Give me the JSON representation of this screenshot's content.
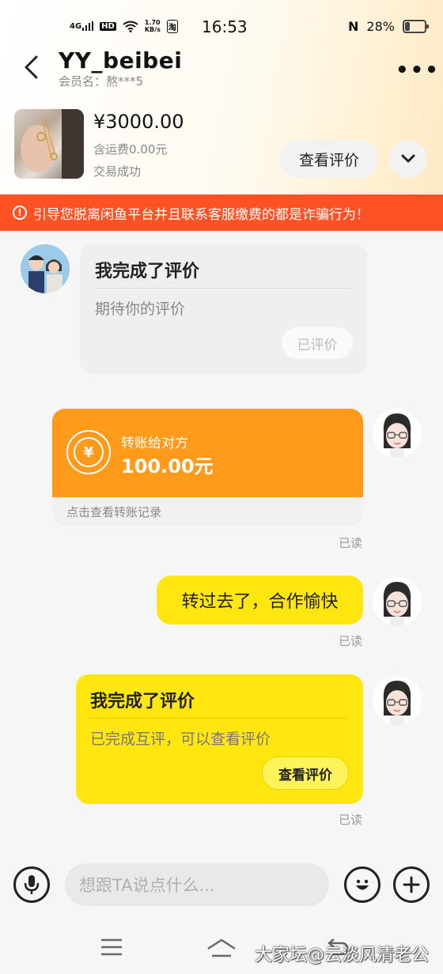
{
  "status_bar": {
    "network": "4G",
    "hd": "HD",
    "speed_value": "1.70",
    "speed_unit": "KB/s",
    "app_badge": "淘",
    "time": "16:53",
    "nfc": "N",
    "battery": "28%"
  },
  "header": {
    "title": "YY_beibei",
    "subtitle": "会员名：熬***5",
    "more": "•••"
  },
  "product": {
    "price": "¥3000.00",
    "shipping": "含运费0.00元",
    "status": "交易成功",
    "review_button": "查看评价"
  },
  "warning": {
    "icon": "!",
    "text": "引导您脱离闲鱼平台并且联系客服缴费的都是诈骗行为！"
  },
  "messages": {
    "review_card_other": {
      "title": "我完成了评价",
      "subtitle": "期待你的评价",
      "button": "已评价"
    },
    "transfer": {
      "label": "转账给对方",
      "amount": "100.00元",
      "footer": "点击查看转账记录",
      "yen": "¥",
      "read": "已读"
    },
    "text_bubble": {
      "text": "转过去了，合作愉快",
      "read": "已读"
    },
    "review_card_mine": {
      "title": "我完成了评价",
      "subtitle": "已完成互评，可以查看评价",
      "button": "查看评价",
      "read": "已读"
    }
  },
  "input_bar": {
    "placeholder": "想跟TA说点什么..."
  },
  "watermark": "大家坛@云淡风清老公",
  "colors": {
    "warning_bg": "#ff5224",
    "transfer_bg": "#ff9a1a",
    "my_bubble": "#ffe60f",
    "other_card": "#efeff1"
  },
  "icons": {
    "back": "chevron-left-icon",
    "expand": "chevron-down-icon",
    "voice": "microphone-icon",
    "emoji": "smile-icon",
    "plus": "plus-icon",
    "nav_menu": "menu-icon",
    "nav_home": "home-icon",
    "nav_back": "back-icon"
  }
}
